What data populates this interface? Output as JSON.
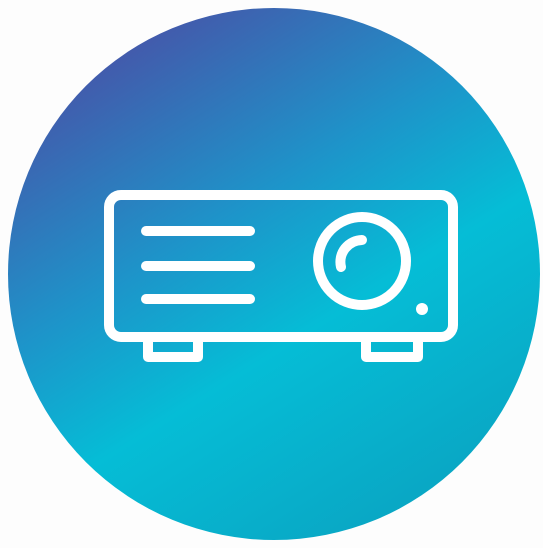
{
  "icon": {
    "name": "projector-icon",
    "background": "#fdfdfd",
    "gradient": {
      "start": "#4a4fa6",
      "middle": "#1e93c9",
      "end": "#05bdd6",
      "tail": "#0aa4c2"
    },
    "stroke_color": "#ffffff"
  }
}
